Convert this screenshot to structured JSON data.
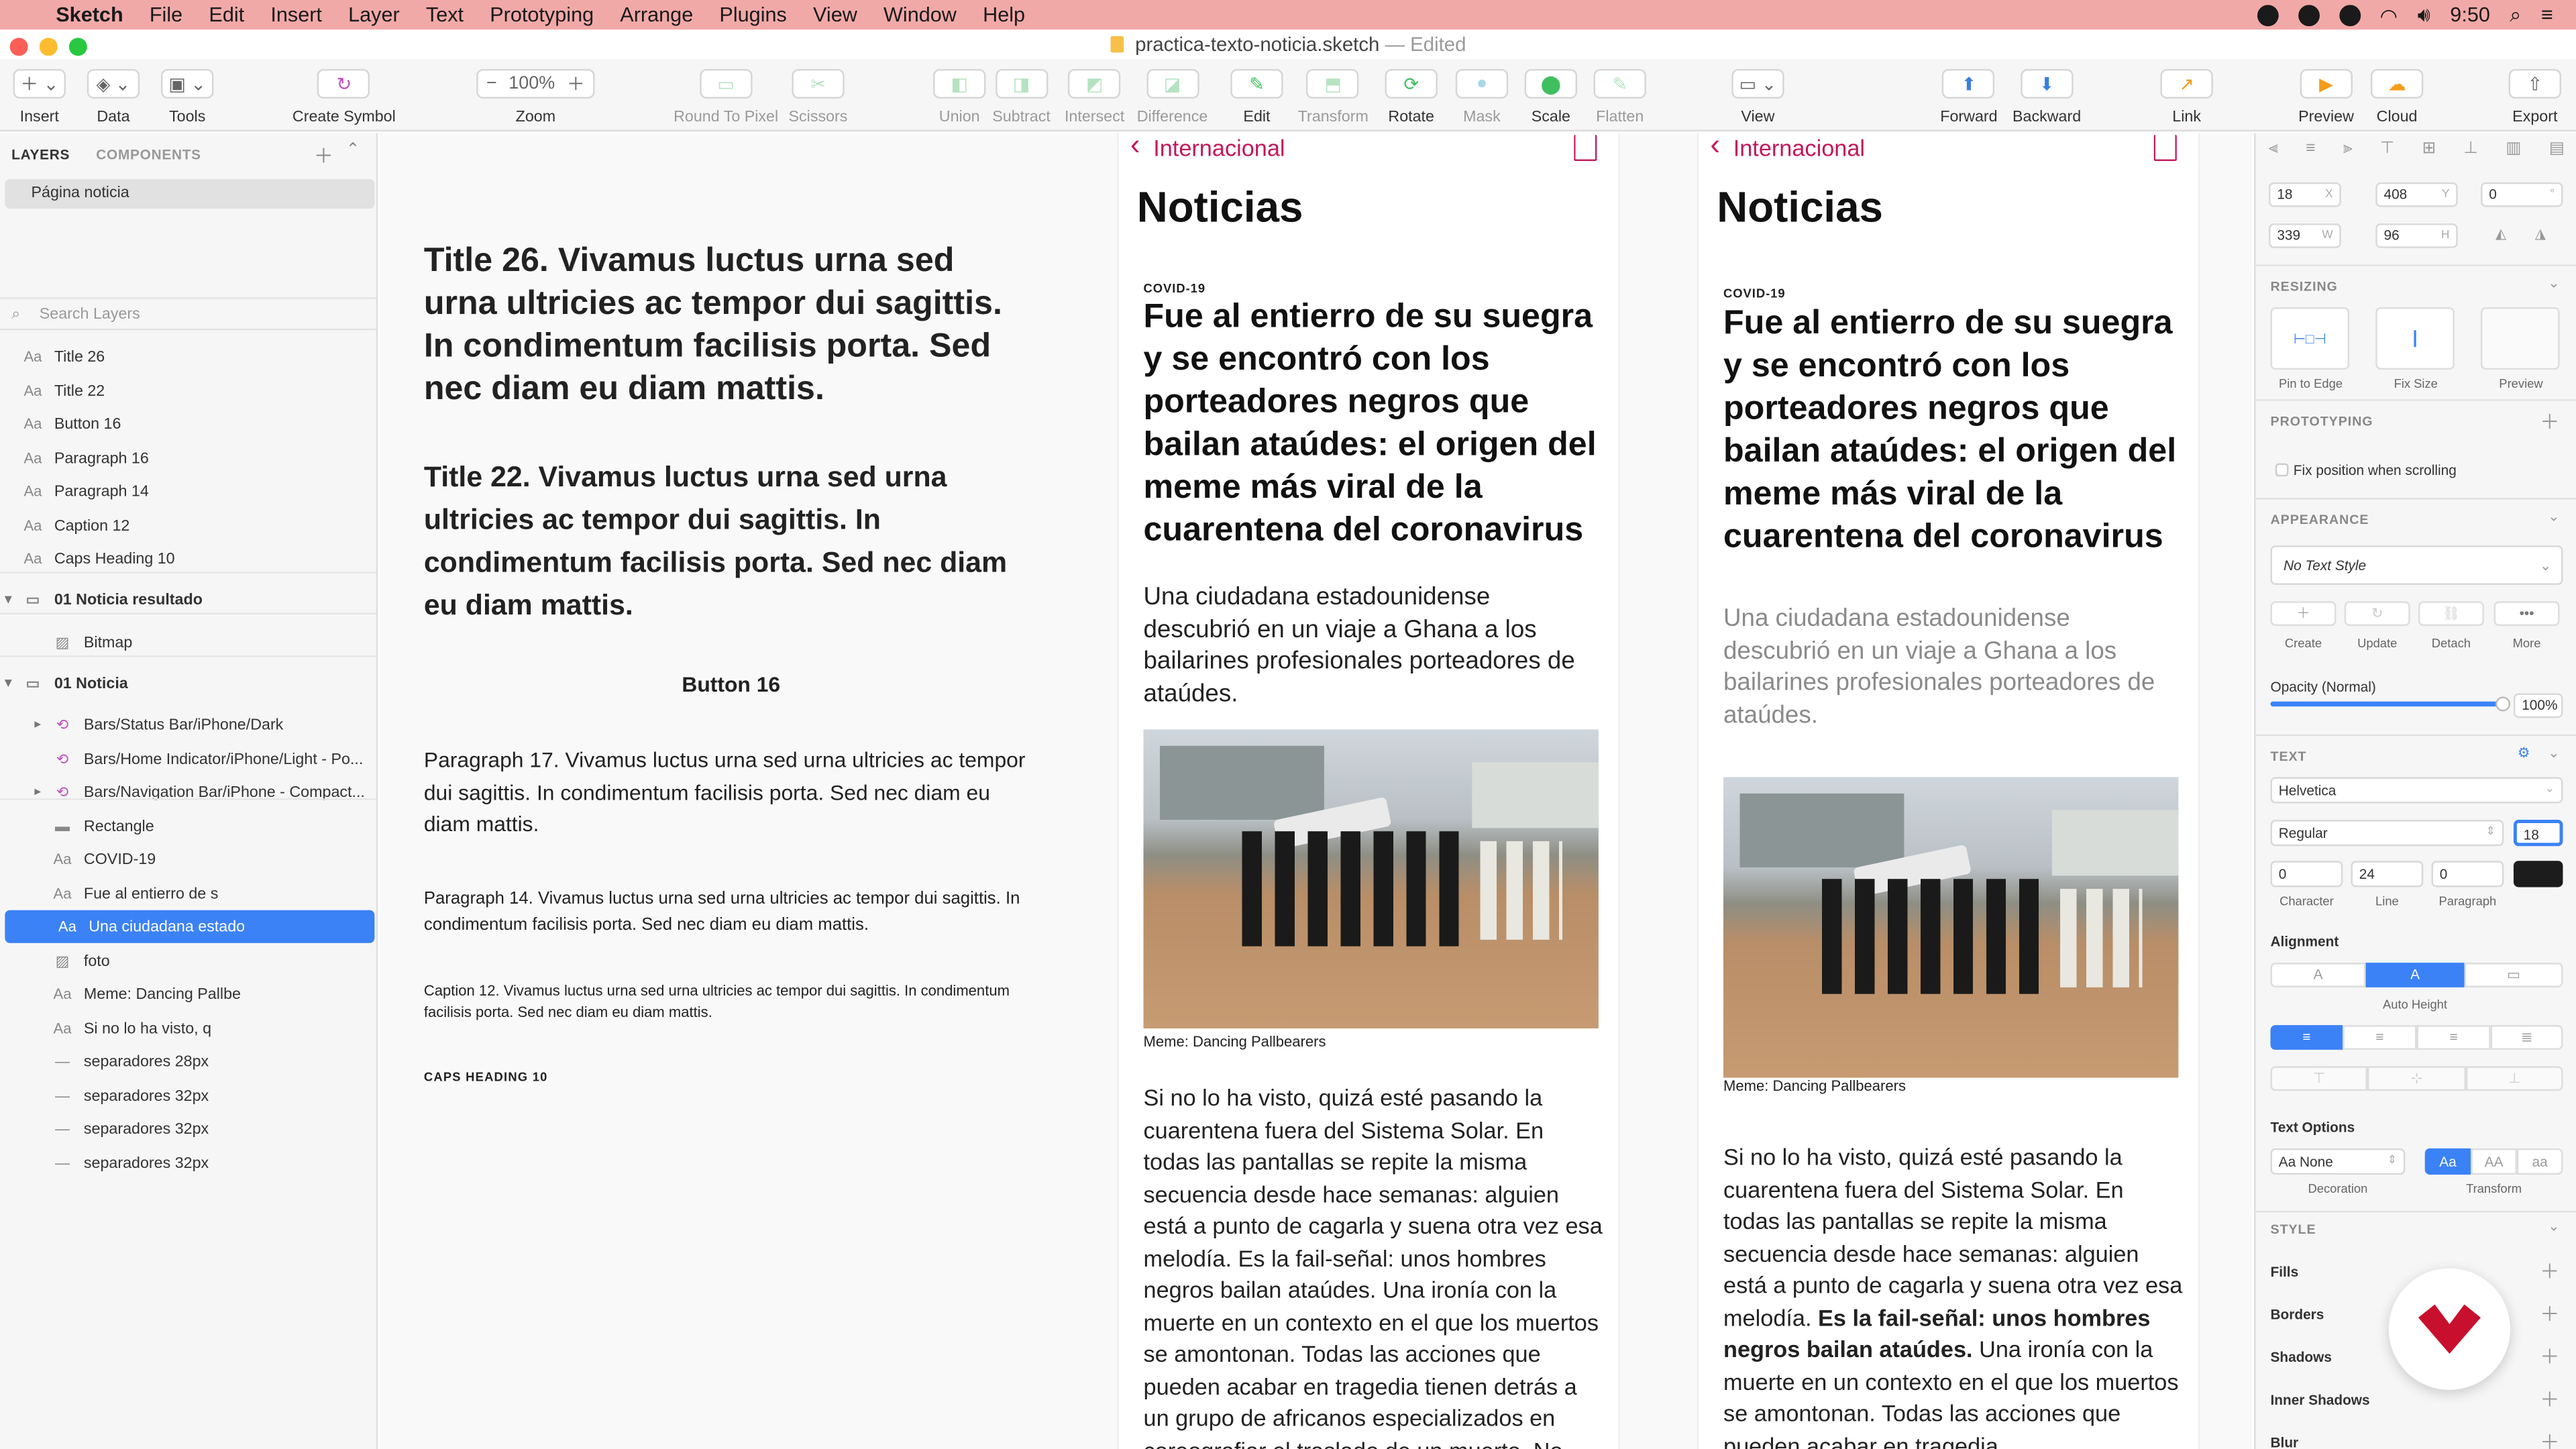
{
  "menubar": {
    "app": "Sketch",
    "items": [
      "File",
      "Edit",
      "Insert",
      "Layer",
      "Text",
      "Prototyping",
      "Arrange",
      "Plugins",
      "View",
      "Window",
      "Help"
    ],
    "time": "9:50"
  },
  "window": {
    "title": "practica-texto-noticia.sketch",
    "status": "— Edited"
  },
  "toolbar": {
    "insert": "Insert",
    "data": "Data",
    "tools": "Tools",
    "create_symbol": "Create Symbol",
    "zoom_value": "100%",
    "zoom": "Zoom",
    "round": "Round To Pixel",
    "scissors": "Scissors",
    "union": "Union",
    "subtract": "Subtract",
    "intersect": "Intersect",
    "difference": "Difference",
    "edit": "Edit",
    "transform": "Transform",
    "rotate": "Rotate",
    "mask": "Mask",
    "scale": "Scale",
    "flatten": "Flatten",
    "view": "View",
    "forward": "Forward",
    "backward": "Backward",
    "link": "Link",
    "preview": "Preview",
    "cloud": "Cloud",
    "export": "Export"
  },
  "layers_panel": {
    "tab_layers": "LAYERS",
    "tab_components": "COMPONENTS",
    "page": "Página noticia",
    "search_placeholder": "Search Layers",
    "items": [
      {
        "label": "Title 26",
        "icon": "text-icon"
      },
      {
        "label": "Title 22",
        "icon": "text-icon"
      },
      {
        "label": "Button 16",
        "icon": "text-icon"
      },
      {
        "label": "Paragraph 16",
        "icon": "text-icon"
      },
      {
        "label": "Paragraph 14",
        "icon": "text-icon"
      },
      {
        "label": "Caption 12",
        "icon": "text-icon"
      },
      {
        "label": "Caps Heading 10",
        "icon": "text-icon"
      },
      {
        "label": "01 Noticia resultado",
        "icon": "artboard-icon"
      },
      {
        "label": "Bitmap",
        "icon": "image-icon"
      },
      {
        "label": "01 Noticia",
        "icon": "artboard-icon"
      },
      {
        "label": "Bars/Status Bar/iPhone/Dark",
        "icon": "symbol-icon"
      },
      {
        "label": "Bars/Home Indicator/iPhone/Light - Po...",
        "icon": "symbol-icon"
      },
      {
        "label": "Bars/Navigation Bar/iPhone - Compact...",
        "icon": "symbol-icon"
      },
      {
        "label": "Rectangle",
        "icon": "rectangle-icon"
      },
      {
        "label": "COVID-19",
        "icon": "text-icon"
      },
      {
        "label": "Fue al entierro de s",
        "icon": "text-icon"
      },
      {
        "label": "Una ciudadana estado",
        "icon": "text-icon"
      },
      {
        "label": "foto",
        "icon": "image-icon"
      },
      {
        "label": "Meme: Dancing Pallbe",
        "icon": "text-icon"
      },
      {
        "label": "Si no lo ha visto, q",
        "icon": "text-icon"
      },
      {
        "label": "separadores 28px",
        "icon": "line-icon"
      },
      {
        "label": "separadores 32px",
        "icon": "line-icon"
      },
      {
        "label": "separadores 32px",
        "icon": "line-icon"
      },
      {
        "label": "separadores 32px",
        "icon": "line-icon"
      }
    ]
  },
  "styles_board": {
    "title26": "Title 26. Vivamus luctus urna sed urna ultricies ac tempor dui sagittis. In condimentum facilisis porta. Sed nec diam eu diam mattis.",
    "title22": "Title 22. Vivamus luctus urna sed urna ultricies ac tempor dui sagittis. In condimentum facilisis porta. Sed nec diam eu diam mattis.",
    "button16": "Button 16",
    "para17": "Paragraph 17. Vivamus luctus urna sed urna ultricies ac tempor dui sagittis. In condimentum facilisis porta. Sed nec diam eu diam mattis.",
    "para14": "Paragraph 14. Vivamus luctus urna sed urna ultricies ac tempor dui sagittis. In condimentum facilisis porta. Sed nec diam eu diam mattis.",
    "caption12": "Caption 12. Vivamus luctus urna sed urna ultricies ac tempor dui sagittis. In condimentum facilisis porta. Sed nec diam eu diam mattis.",
    "caps10": "CAPS HEADING 10"
  },
  "article": {
    "back": "Internacional",
    "nav_title": "Noticias",
    "kicker": "COVID-19",
    "headline": "Fue al entierro de su suegra y se encontró con los porteadores negros que bailan ataúdes: el origen del meme más viral de la cuarentena del coronavirus",
    "lead": "Una ciudadana estadounidense descubrió en un viaje a Ghana a los bailarines profesionales porteadores de ataúdes.",
    "caption": "Meme: Dancing Pallbearers",
    "body": "Si no lo ha visto, quizá esté pasando la cuarentena fuera del Sistema Solar. En todas las pantallas se repite la misma secuencia desde hace semanas: alguien está a punto de cagarla y suena otra vez esa melodía. Es la fail-señal: unos hombres negros bailan ataúdes. Una ironía con la muerte en un contexto en el que los muertos se amontonan. Todas las acciones que pueden acabar en tragedia tienen detrás a un grupo de africanos especializados en coreografiar el traslado de un muerto. No",
    "body2_a": "Si no lo ha visto, quizá esté pasando la cuarentena fuera del Sistema Solar. En todas las pantallas se repite la misma secuencia desde hace semanas: alguien está a punto de cagarla y suena otra vez esa melodía.",
    "body2_bold": "Es la fail-señal: unos hombres negros bailan ataúdes.",
    "body2_b": "Una ironía con la muerte en un contexto en el que los muertos se amontonan. Todas las acciones que pueden acabar en tragedia"
  },
  "inspector": {
    "x": "18",
    "y": "408",
    "rot": "0",
    "w": "339",
    "h": "96",
    "x_label": "X",
    "y_label": "Y",
    "w_label": "W",
    "h_label": "H",
    "resizing": "RESIZING",
    "pin": "Pin to Edge",
    "fix": "Fix Size",
    "preview": "Preview",
    "prototyping": "PROTOTYPING",
    "fix_scroll": "Fix position when scrolling",
    "appearance": "APPEARANCE",
    "text_style": "No Text Style",
    "create": "Create",
    "update": "Update",
    "detach": "Detach",
    "more": "More",
    "opacity_label": "Opacity (Normal)",
    "opacity": "100%",
    "text": "TEXT",
    "font": "Helvetica",
    "weight": "Regular",
    "size": "18",
    "character": "0",
    "line": "24",
    "paragraph": "0",
    "character_label": "Character",
    "line_label": "Line",
    "paragraph_label": "Paragraph",
    "alignment": "Alignment",
    "auto_height": "Auto Height",
    "text_options": "Text Options",
    "decoration": "Aa None",
    "decoration_label": "Decoration",
    "transform_label": "Transform",
    "t1": "Aa",
    "t2": "AA",
    "t3": "aa",
    "style": "STYLE",
    "fills": "Fills",
    "borders": "Borders",
    "shadows": "Shadows",
    "inner_shadows": "Inner Shadows",
    "blur": "Blur"
  },
  "colors": {
    "accent": "#3b82f6",
    "menubar": "#f1a9a8",
    "link": "#c2185b",
    "brand_red": "#c8102e"
  }
}
